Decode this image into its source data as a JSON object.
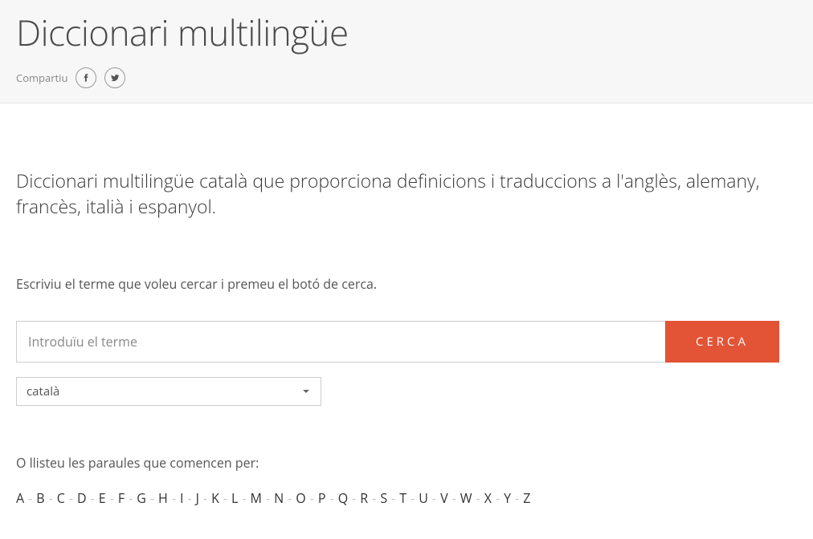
{
  "header": {
    "title": "Diccionari multilingüe",
    "share_label": "Compartiu"
  },
  "description": "Diccionari multilingüe català que proporciona definicions i traduccions a l'anglès, alemany, francès, italià i espanyol.",
  "search": {
    "instruction": "Escriviu el terme que voleu cercar i premeu el botó de cerca.",
    "placeholder": "Introduïu el terme",
    "button_label": "CERCA",
    "language_selected": "català"
  },
  "list_by_letter": {
    "instruction": "O llisteu les paraules que comencen per:",
    "letters": [
      "A",
      "B",
      "C",
      "D",
      "E",
      "F",
      "G",
      "H",
      "I",
      "J",
      "K",
      "L",
      "M",
      "N",
      "O",
      "P",
      "Q",
      "R",
      "S",
      "T",
      "U",
      "V",
      "W",
      "X",
      "Y",
      "Z"
    ]
  }
}
